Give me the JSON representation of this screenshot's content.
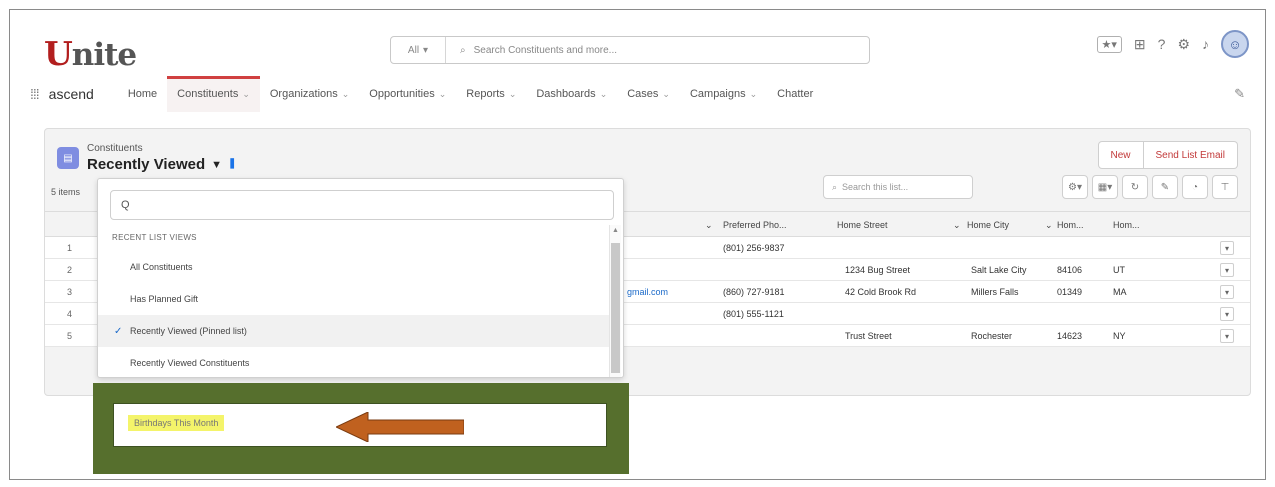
{
  "header": {
    "logo_initial": "U",
    "logo_rest": "nite",
    "search_scope": "All",
    "search_placeholder": "Search Constituents and more..."
  },
  "nav": {
    "app_name": "ascend",
    "items": [
      {
        "label": "Home",
        "chevron": false
      },
      {
        "label": "Constituents",
        "chevron": true,
        "active": true
      },
      {
        "label": "Organizations",
        "chevron": true
      },
      {
        "label": "Opportunities",
        "chevron": true
      },
      {
        "label": "Reports",
        "chevron": true
      },
      {
        "label": "Dashboards",
        "chevron": true
      },
      {
        "label": "Cases",
        "chevron": true
      },
      {
        "label": "Campaigns",
        "chevron": true
      },
      {
        "label": "Chatter",
        "chevron": false
      }
    ]
  },
  "list": {
    "object_label": "Constituents",
    "title": "Recently Viewed",
    "item_count": "5 items",
    "new_button": "New",
    "send_email_button": "Send List Email",
    "search_placeholder": "Search this list..."
  },
  "table": {
    "headers": {
      "phone": "Preferred Pho...",
      "street": "Home Street",
      "city": "Home City",
      "zip": "Hom...",
      "state": "Hom..."
    },
    "rows": [
      {
        "num": "1",
        "email": "",
        "phone": "(801) 256-9837",
        "street": "",
        "city": "",
        "zip": "",
        "state": ""
      },
      {
        "num": "2",
        "email": "",
        "phone": "",
        "street": "1234 Bug Street",
        "city": "Salt Lake City",
        "zip": "84106",
        "state": "UT"
      },
      {
        "num": "3",
        "email": "gmail.com",
        "phone": "(860) 727-9181",
        "street": "42 Cold Brook Rd",
        "city": "Millers Falls",
        "zip": "01349",
        "state": "MA"
      },
      {
        "num": "4",
        "email": "",
        "phone": "(801) 555-1121",
        "street": "",
        "city": "",
        "zip": "",
        "state": ""
      },
      {
        "num": "5",
        "email": "",
        "phone": "",
        "street": "Trust Street",
        "city": "Rochester",
        "zip": "14623",
        "state": "NY"
      }
    ]
  },
  "dropdown": {
    "search_placeholder": "Q",
    "section_heading": "RECENT LIST VIEWS",
    "items": [
      {
        "label": "All Constituents",
        "selected": false
      },
      {
        "label": "Has Planned Gift",
        "selected": false
      },
      {
        "label": "Recently Viewed (Pinned list)",
        "selected": true
      },
      {
        "label": "Recently Viewed Constituents",
        "selected": false
      }
    ]
  },
  "highlight": {
    "label": "Birthdays This Month",
    "box_color": "#566f2d",
    "arrow_color": "#c0611f",
    "label_bg": "#f4f46a"
  }
}
